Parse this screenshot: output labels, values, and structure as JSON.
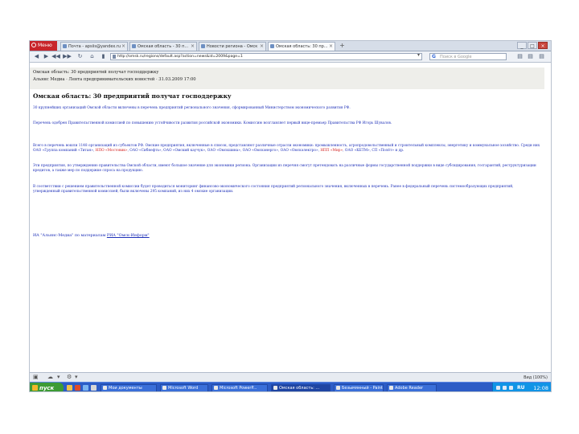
{
  "browser": {
    "menu_label": "Меню",
    "tabs": [
      {
        "label": "Почта - apsiis@yandex.ru"
      },
      {
        "label": "Омская область - 30 п..."
      },
      {
        "label": "Новости региона - Омск"
      },
      {
        "label": "Омская область: 30 пр..."
      }
    ],
    "url": "http://omsk.ru/regions/default.asp?action=news&id=2009&page=1",
    "search_placeholder": "Поиск в Google",
    "search_engine_icon": "google-icon"
  },
  "page": {
    "crumb_title": "Омская область: 30 предприятий получат господдержку",
    "crumb_source": "Альянс Медиа · Лента предпринимательских новостей · 31.03.2009 17:00",
    "headline": "Омская область: 30 предприятий получат господдержку",
    "paragraphs": [
      {
        "text": "30 крупнейших организаций Омской области включены в перечень предприятий регионального значения, сформированный Министерством экономического развития РФ."
      },
      {
        "text": "Перечень одобрен Правительственной комиссией по повышению устойчивости развития российской экономики. Комиссию возглавляет первый вице-премьер Правительства РФ Игорь Шувалов."
      },
      {
        "segments": [
          {
            "text": "Всего в перечень вошли 1148 организаций из субъектов РФ. Омские предприятия, включенные в список, представляют различные отрасли экономики: промышленность, агропродовольственный и строительный комплексы, энергетику и коммунальное хозяйство. Среди них ОАО «Группа компаний «Титан», ",
            "style": ""
          },
          {
            "text": "НПО «Мостовик»",
            "style": "red"
          },
          {
            "text": ", ОАО «Сибнефть», ОАО «Омский каучук», ОАО «Омскшина», ОАО «Омскэнерго», ОАО «Омскэлектро», ",
            "style": ""
          },
          {
            "text": "НПП «Мир»",
            "style": "red"
          },
          {
            "text": ", ОАО «КБТМ», СП «Полёт» и др.",
            "style": ""
          }
        ]
      },
      {
        "text": "Эти предприятия, по утверждению правительства Омской области, имеют большое значение для экономики региона. Организации из перечня смогут претендовать на различные формы государственной поддержки в виде субсидирования, госгарантий, реструктуризации кредитов, а также мер по поддержке спроса на продукцию."
      },
      {
        "text": "В соответствии с решением правительственной комиссии будет проводиться мониторинг финансово-экономического состояния предприятий регионального значения, включенных в перечень. Ранее в федеральный перечень системообразующих предприятий, утвержденный правительственной комиссией, были включены 295 компаний, из них 4 омские организации."
      }
    ],
    "source_prefix": "ИА \"Альянс-Медиа\" по материалам ",
    "source_link": "РИА \"Омск-Информ\""
  },
  "status": {
    "zoom": "Вид (100%)"
  },
  "taskbar": {
    "start_label": "пуск",
    "tasks": [
      {
        "label": "Мои документы"
      },
      {
        "label": "Microsoft Word"
      },
      {
        "label": "Microsoft PowerP..."
      },
      {
        "label": "Омская область: ..."
      },
      {
        "label": "Безымянный - Paint"
      },
      {
        "label": "Adobe Reader"
      }
    ],
    "lang": "RU",
    "clock": "12:08"
  },
  "colors": {
    "link_text": "#1d2fb8",
    "highlight_red": "#d11b1b",
    "taskbar_blue": "#2c5cc6",
    "start_green": "#3d9b35"
  }
}
